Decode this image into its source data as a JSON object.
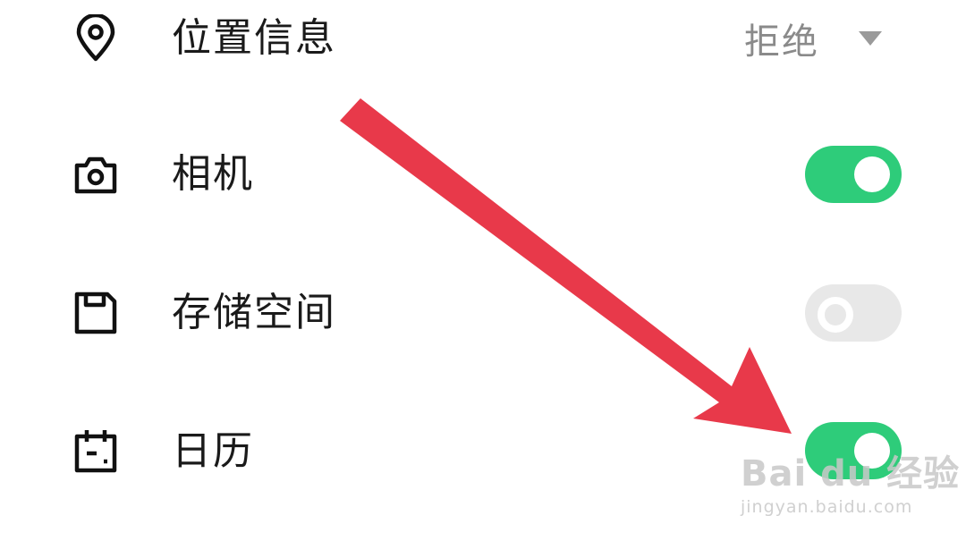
{
  "settings": {
    "rows": [
      {
        "label": "位置信息",
        "icon": "location-pin-icon",
        "control": "dropdown",
        "value": "拒绝"
      },
      {
        "label": "相机",
        "icon": "camera-icon",
        "control": "toggle",
        "enabled": true
      },
      {
        "label": "存储空间",
        "icon": "floppy-disk-icon",
        "control": "toggle",
        "enabled": false
      },
      {
        "label": "日历",
        "icon": "calendar-icon",
        "control": "toggle",
        "enabled": true
      }
    ]
  },
  "annotation": {
    "arrow_color": "#e8394a"
  },
  "colors": {
    "toggle_on": "#2ecc7a",
    "toggle_off": "#e8e8e8",
    "label_text": "#1a1a1a",
    "value_text": "#8a8a8a"
  },
  "watermark": {
    "brand": "Bai du 经验",
    "url": "jingyan.baidu.com"
  }
}
